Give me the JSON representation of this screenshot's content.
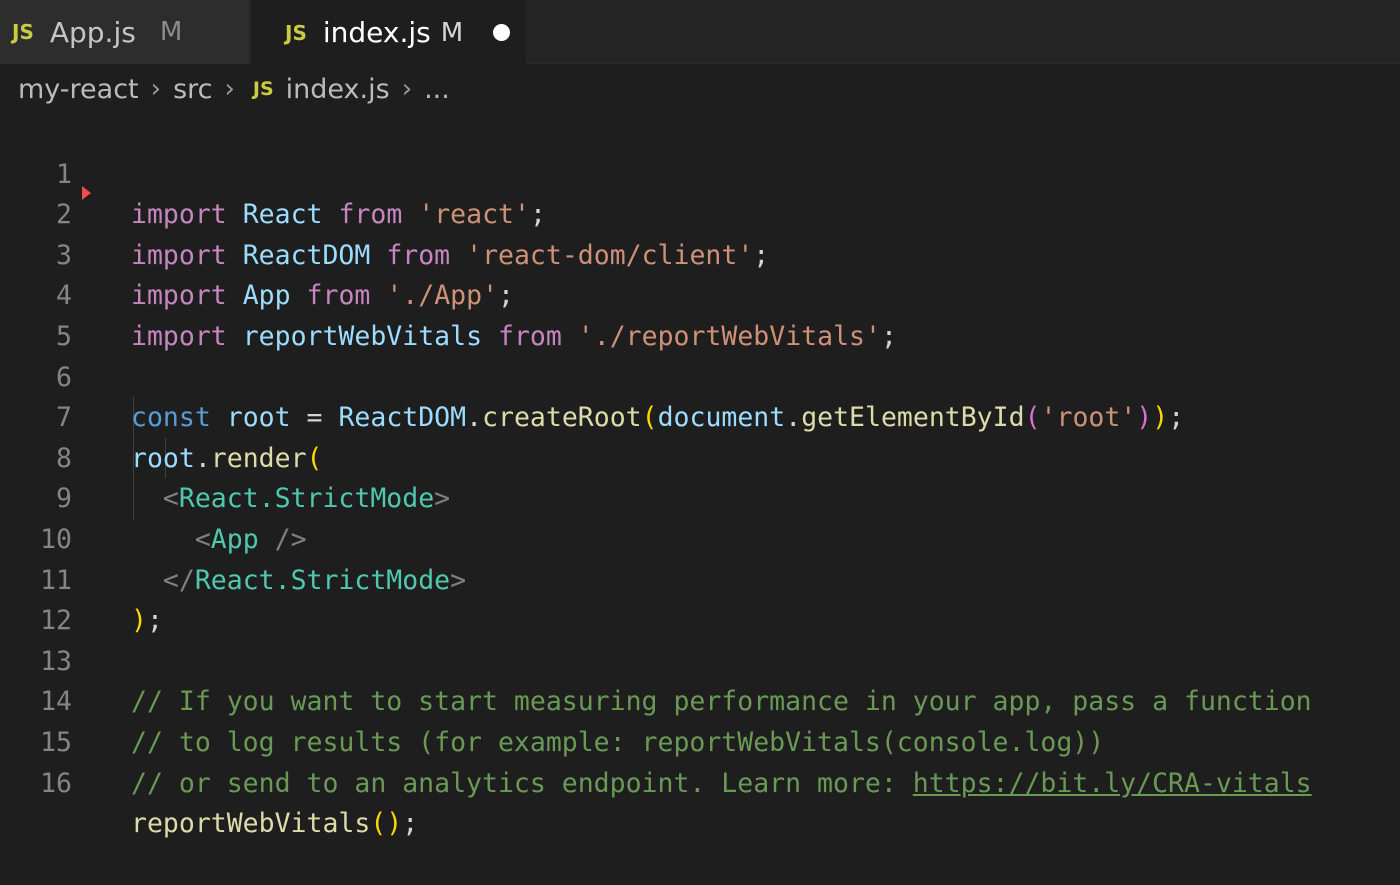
{
  "tabs": [
    {
      "badge": "JS",
      "name": "App.js",
      "status": "M"
    },
    {
      "badge": "JS",
      "name": "index.js",
      "status": "M"
    }
  ],
  "breadcrumb": {
    "items": [
      "my-react",
      "src"
    ],
    "file_badge": "JS",
    "file": "index.js",
    "ellipsis": "..."
  },
  "colors": {
    "keyword": "#c586c0",
    "storage": "#569cd6",
    "variable": "#9cdcfe",
    "string": "#ce9178",
    "function": "#dcdcaa",
    "component": "#4ec9b0",
    "comment": "#6a9955",
    "js_badge": "#cbcb41"
  },
  "code": {
    "line_numbers": [
      "1",
      "2",
      "3",
      "4",
      "5",
      "6",
      "7",
      "8",
      "9",
      "10",
      "11",
      "12",
      "13",
      "14",
      "15",
      "16"
    ],
    "l1": {
      "kw": "import",
      "name": "React",
      "from": "from",
      "str": "'react'",
      "end": ";"
    },
    "l2": {
      "kw": "import",
      "name": "ReactDOM",
      "from": "from",
      "str": "'react-dom/client'",
      "end": ";"
    },
    "l3": {
      "kw": "import",
      "name": "App",
      "from": "from",
      "str": "'./App'",
      "end": ";"
    },
    "l4": {
      "kw": "import",
      "name": "reportWebVitals",
      "from": "from",
      "str": "'./reportWebVitals'",
      "end": ";"
    },
    "l6": {
      "kw": "const",
      "name": "root",
      "eq": " = ",
      "obj": "ReactDOM",
      "dot": ".",
      "fn": "createRoot",
      "p1": "(",
      "arg": "document",
      "dot2": ".",
      "fn2": "getElementById",
      "p2": "(",
      "str": "'root'",
      "p2c": ")",
      "p1c": ")",
      "end": ";"
    },
    "l7": {
      "name": "root",
      "dot": ".",
      "fn": "render",
      "p": "("
    },
    "l8": {
      "open": "<",
      "comp": "React.StrictMode",
      "close": ">"
    },
    "l9": {
      "open": "<",
      "comp": "App",
      "close": " />"
    },
    "l10": {
      "open": "</",
      "comp": "React.StrictMode",
      "close": ">"
    },
    "l11": {
      "p": ")",
      "end": ";"
    },
    "l13": {
      "text": "// If you want to start measuring performance in your app, pass a function"
    },
    "l14": {
      "text": "// to log results (for example: reportWebVitals(console.log))"
    },
    "l15": {
      "text": "// or send to an analytics endpoint. Learn more: ",
      "link": "https://bit.ly/CRA-vitals"
    },
    "l16": {
      "fn": "reportWebVitals",
      "p": "()",
      "end": ";"
    }
  }
}
